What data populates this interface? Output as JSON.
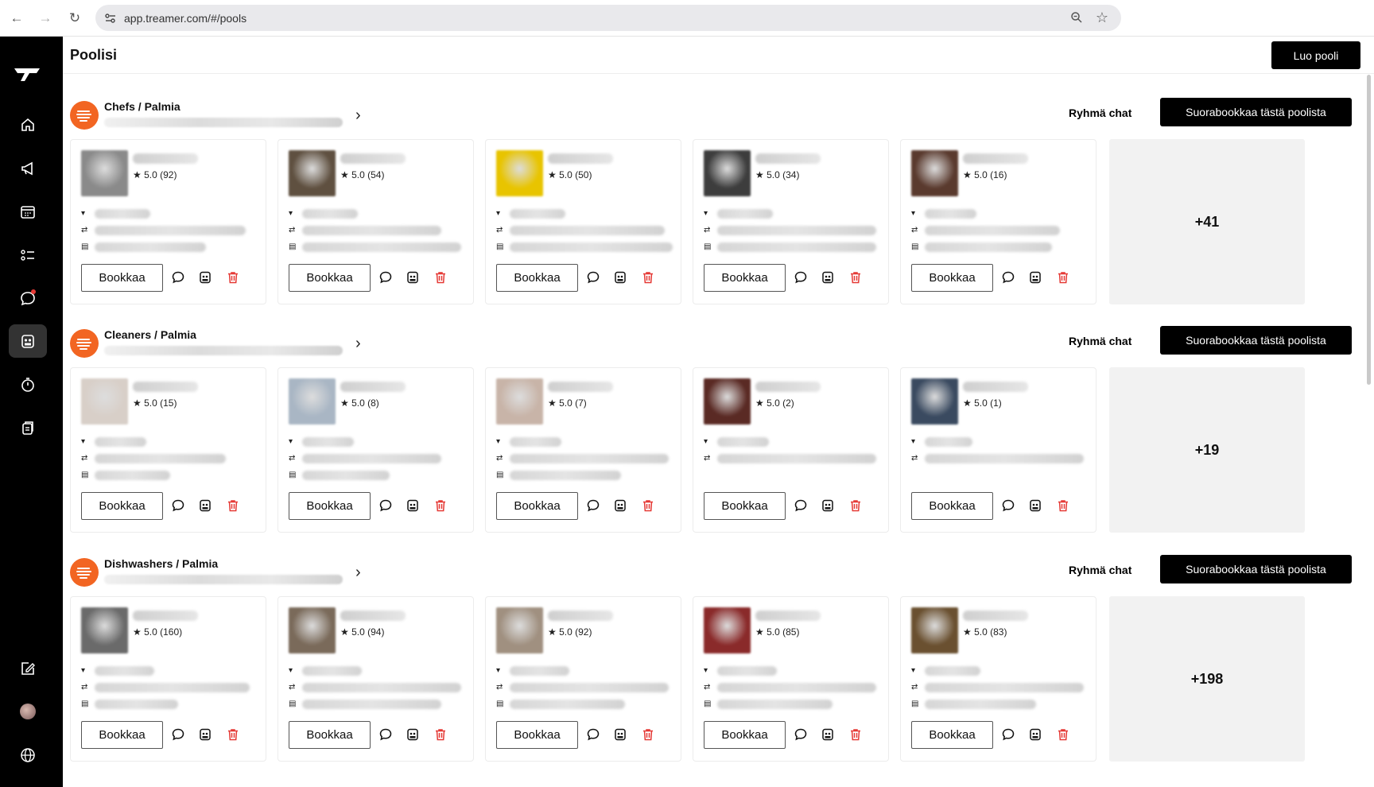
{
  "browser": {
    "url": "app.treamer.com/#/pools"
  },
  "sidebar": {
    "items": [
      "home-icon",
      "megaphone-icon",
      "calendar-icon",
      "checklist-icon",
      "chat-icon",
      "pools-icon",
      "stopwatch-icon",
      "documents-icon"
    ],
    "bottom": [
      "edit-icon",
      "avatar",
      "globe-icon"
    ]
  },
  "header": {
    "title": "Poolisi",
    "create_label": "Luo pooli"
  },
  "pools": [
    {
      "name": "Chefs / Palmia",
      "group_chat": "Ryhmä chat",
      "direct_book": "Suorabookkaa tästä poolista",
      "more": "+41",
      "members": [
        {
          "rating": "★ 5.0 (92)",
          "book": "Bookkaa"
        },
        {
          "rating": "★ 5.0 (54)",
          "book": "Bookkaa"
        },
        {
          "rating": "★ 5.0 (50)",
          "book": "Bookkaa"
        },
        {
          "rating": "★ 5.0 (34)",
          "book": "Bookkaa"
        },
        {
          "rating": "★ 5.0 (16)",
          "book": "Bookkaa"
        }
      ]
    },
    {
      "name": "Cleaners / Palmia",
      "group_chat": "Ryhmä chat",
      "direct_book": "Suorabookkaa tästä poolista",
      "more": "+19",
      "members": [
        {
          "rating": "★ 5.0 (15)",
          "book": "Bookkaa"
        },
        {
          "rating": "★ 5.0 (8)",
          "book": "Bookkaa"
        },
        {
          "rating": "★ 5.0 (7)",
          "book": "Bookkaa"
        },
        {
          "rating": "★ 5.0 (2)",
          "book": "Bookkaa"
        },
        {
          "rating": "★ 5.0 (1)",
          "book": "Bookkaa"
        }
      ]
    },
    {
      "name": "Dishwashers / Palmia",
      "group_chat": "Ryhmä chat",
      "direct_book": "Suorabookkaa tästä poolista",
      "more": "+198",
      "members": [
        {
          "rating": "★ 5.0 (160)",
          "book": "Bookkaa"
        },
        {
          "rating": "★ 5.0 (94)",
          "book": "Bookkaa"
        },
        {
          "rating": "★ 5.0 (92)",
          "book": "Bookkaa"
        },
        {
          "rating": "★ 5.0 (85)",
          "book": "Bookkaa"
        },
        {
          "rating": "★ 5.0 (83)",
          "book": "Bookkaa"
        }
      ]
    }
  ],
  "colors": {
    "sidebar_bg": "#000000",
    "brand_orange": "#f26522",
    "delete_red": "#e53935",
    "more_bg": "#f2f2f2"
  }
}
